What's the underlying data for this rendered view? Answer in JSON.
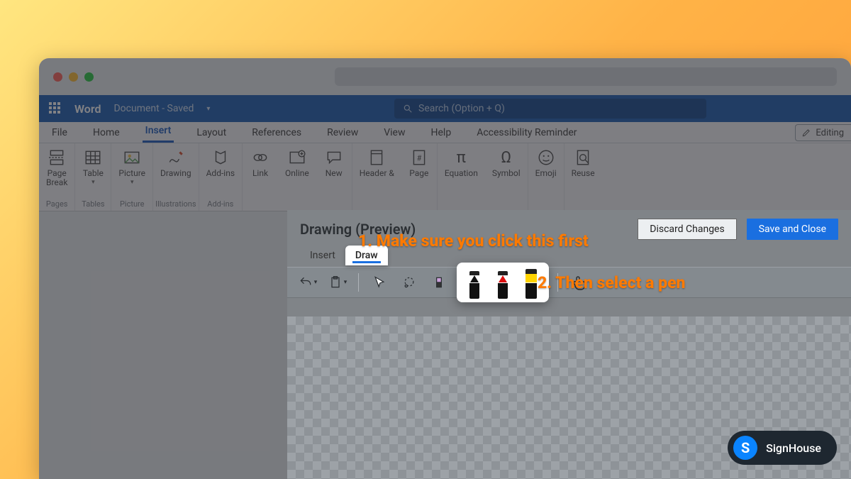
{
  "wordbar": {
    "app_name": "Word",
    "doc_status": "Document  -  Saved",
    "search_placeholder": "Search (Option + Q)"
  },
  "tabs": [
    "File",
    "Home",
    "Insert",
    "Layout",
    "References",
    "Review",
    "View",
    "Help",
    "Accessibility Reminder"
  ],
  "active_tab_index": 2,
  "editing_label": "Editing",
  "ribbon_groups": [
    {
      "label": "Pages",
      "items": [
        {
          "label": "Page\nBreak",
          "dd": false
        }
      ]
    },
    {
      "label": "Tables",
      "items": [
        {
          "label": "Table",
          "dd": true
        }
      ]
    },
    {
      "label": "Picture",
      "items": [
        {
          "label": "Picture",
          "dd": true
        }
      ]
    },
    {
      "label": "Illustrations",
      "items": [
        {
          "label": "Drawing",
          "dd": false
        }
      ]
    },
    {
      "label": "Add-ins",
      "items": [
        {
          "label": "Add-ins",
          "dd": false
        }
      ]
    },
    {
      "label": "",
      "items": [
        {
          "label": "Link",
          "dd": false
        },
        {
          "label": "Online",
          "dd": false
        },
        {
          "label": "New",
          "dd": false
        }
      ]
    },
    {
      "label": "",
      "items": [
        {
          "label": "Header &",
          "dd": false
        },
        {
          "label": "Page",
          "dd": false
        }
      ]
    },
    {
      "label": "",
      "items": [
        {
          "label": "Equation",
          "dd": false
        },
        {
          "label": "Symbol",
          "dd": false
        }
      ]
    },
    {
      "label": "",
      "items": [
        {
          "label": "Emoji",
          "dd": false
        }
      ]
    },
    {
      "label": "",
      "items": [
        {
          "label": "Reuse",
          "dd": false
        }
      ]
    }
  ],
  "drawing_panel": {
    "title": "Drawing (Preview)",
    "discard_label": "Discard Changes",
    "save_label": "Save and Close",
    "insert_tab": "Insert",
    "draw_tab": "Draw",
    "pens": [
      {
        "name": "pen-black",
        "tip": "#111",
        "body": "#111"
      },
      {
        "name": "pen-red",
        "tip": "#d11",
        "body": "#d11"
      },
      {
        "name": "highlighter-yellow",
        "tip": "#ffd400",
        "body": "#ffd400"
      }
    ]
  },
  "annotations": {
    "a1": "1. Make sure you click this first",
    "a2": "2. Then select a pen"
  },
  "badge": {
    "initial": "S",
    "label": "SignHouse"
  }
}
